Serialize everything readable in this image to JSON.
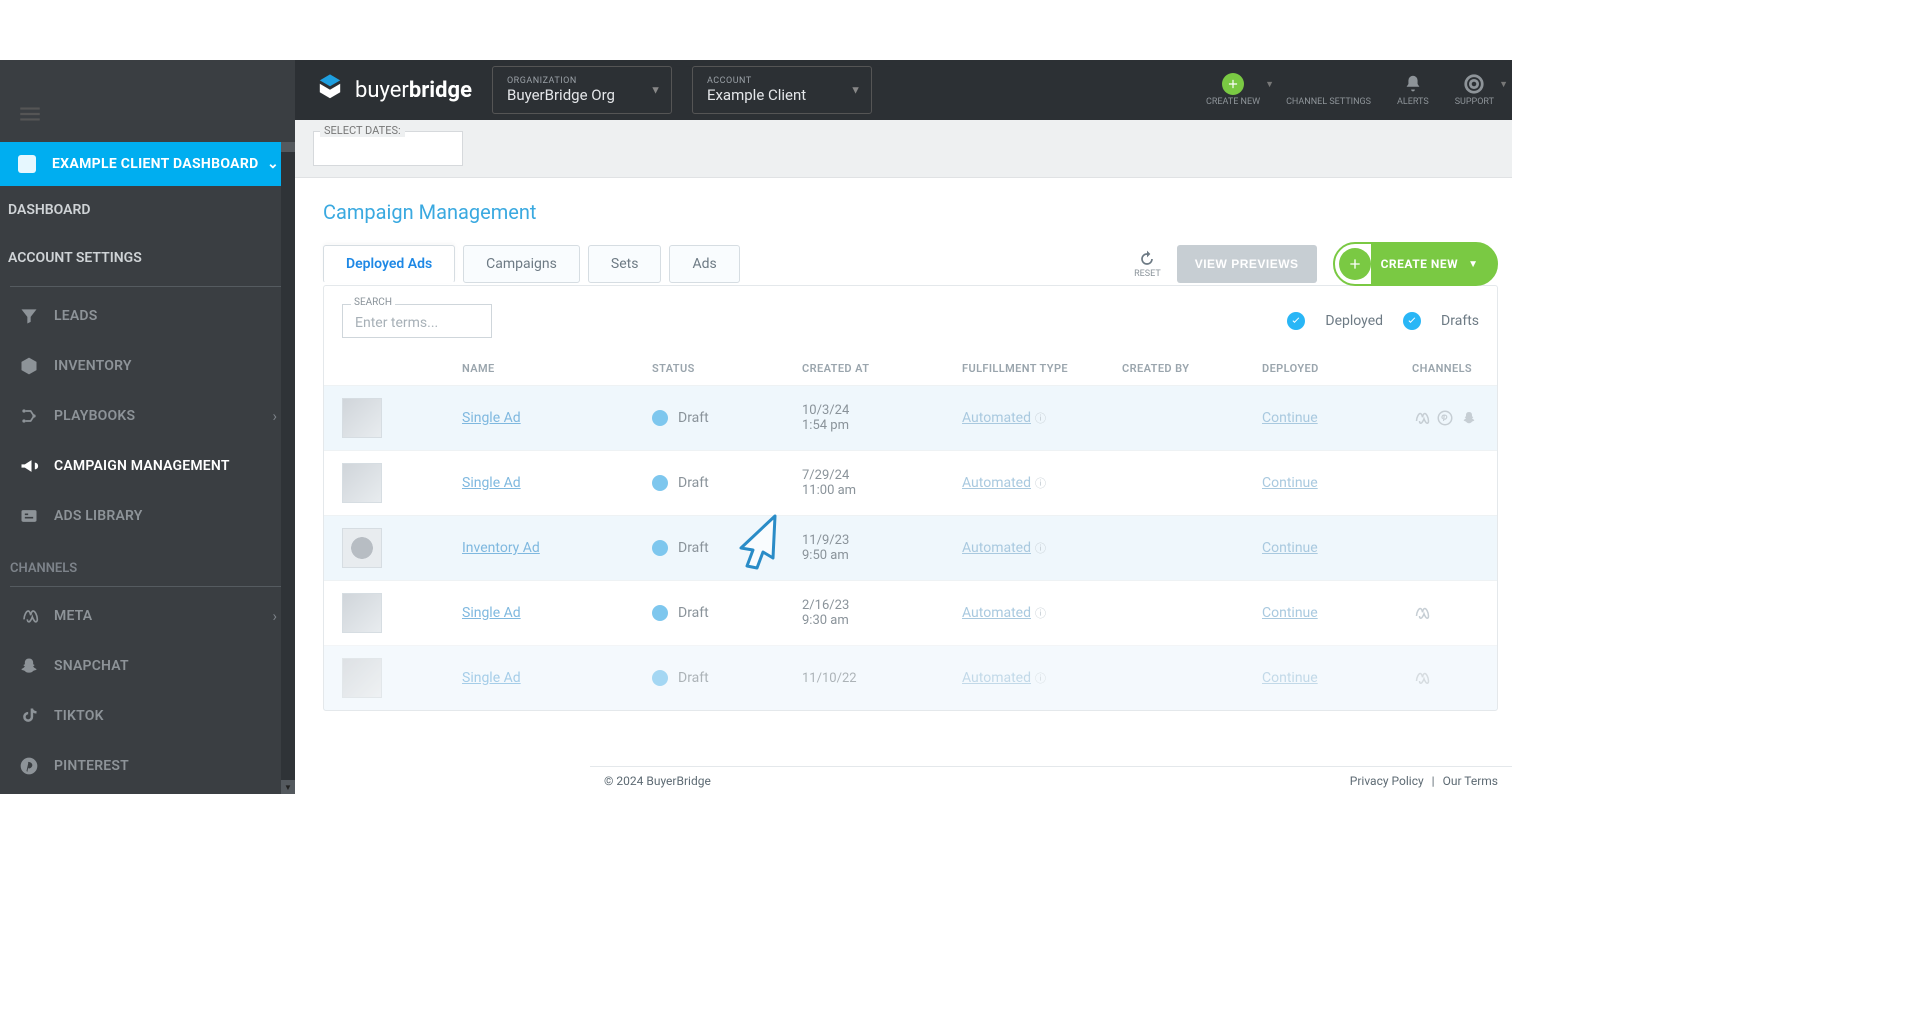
{
  "topbar": {
    "brand_left": "buyer",
    "brand_right": "bridge",
    "org_label": "ORGANIZATION",
    "org_value": "BuyerBridge Org",
    "account_label": "ACCOUNT",
    "account_value": "Example Client",
    "actions": {
      "create": "CREATE NEW",
      "channel": "CHANNEL SETTINGS",
      "alerts": "ALERTS",
      "support": "SUPPORT"
    }
  },
  "subbar": {
    "dates_label": "SELECT DATES:"
  },
  "sidebar": {
    "active_banner": "EXAMPLE CLIENT DASHBOARD",
    "dashboard": "DASHBOARD",
    "account_settings": "ACCOUNT SETTINGS",
    "items": [
      {
        "label": "LEADS"
      },
      {
        "label": "INVENTORY"
      },
      {
        "label": "PLAYBOOKS"
      },
      {
        "label": "CAMPAIGN MANAGEMENT"
      },
      {
        "label": "ADS LIBRARY"
      }
    ],
    "channels_header": "CHANNELS",
    "channels": [
      {
        "label": "META"
      },
      {
        "label": "SNAPCHAT"
      },
      {
        "label": "TIKTOK"
      },
      {
        "label": "PINTEREST"
      }
    ]
  },
  "page": {
    "title": "Campaign Management",
    "tabs": [
      "Deployed Ads",
      "Campaigns",
      "Sets",
      "Ads"
    ],
    "reset": "RESET",
    "view_previews": "VIEW PREVIEWS",
    "create_new": "CREATE NEW",
    "search_label": "SEARCH",
    "search_placeholder": "Enter terms...",
    "legend_deployed": "Deployed",
    "legend_drafts": "Drafts",
    "columns": [
      "NAME",
      "STATUS",
      "CREATED AT",
      "FULFILLMENT TYPE",
      "CREATED BY",
      "DEPLOYED",
      "CHANNELS"
    ],
    "rows": [
      {
        "name": "Single Ad",
        "status": "Draft",
        "date1": "10/3/24",
        "date2": "1:54 pm",
        "fulfill": "Automated",
        "deploy": "Continue",
        "channels": [
          "meta",
          "pinterest",
          "snapchat"
        ]
      },
      {
        "name": "Single Ad",
        "status": "Draft",
        "date1": "7/29/24",
        "date2": "11:00 am",
        "fulfill": "Automated",
        "deploy": "Continue",
        "channels": []
      },
      {
        "name": "Inventory Ad",
        "status": "Draft",
        "date1": "11/9/23",
        "date2": "9:50 am",
        "fulfill": "Automated",
        "deploy": "Continue",
        "channels": []
      },
      {
        "name": "Single Ad",
        "status": "Draft",
        "date1": "2/16/23",
        "date2": "9:30 am",
        "fulfill": "Automated",
        "deploy": "Continue",
        "channels": [
          "meta"
        ]
      },
      {
        "name": "Single Ad",
        "status": "Draft",
        "date1": "11/10/22",
        "date2": "",
        "fulfill": "Automated",
        "deploy": "Continue",
        "channels": [
          "meta"
        ]
      }
    ]
  },
  "footer": {
    "copyright": "© 2024 BuyerBridge",
    "privacy": "Privacy Policy",
    "terms": "Our Terms"
  }
}
